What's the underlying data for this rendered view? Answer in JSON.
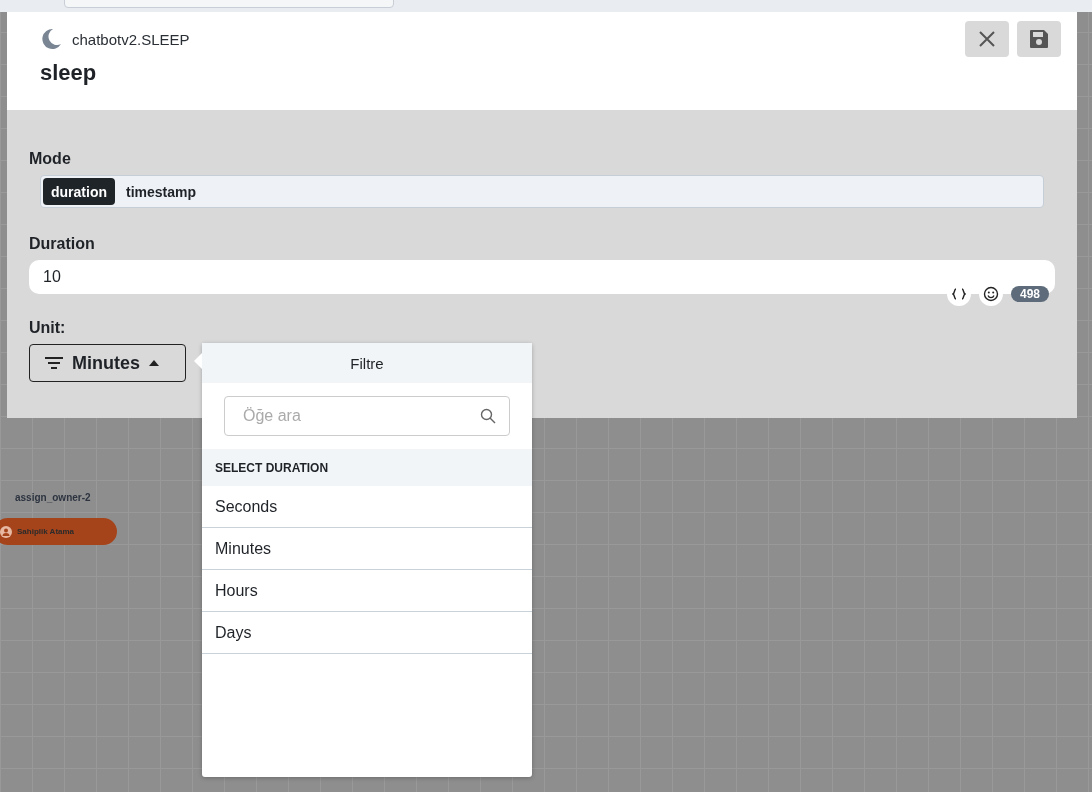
{
  "canvas": {
    "nodes": [
      {
        "name": "assign_owner-2",
        "label": "Sahiplik Atama"
      }
    ]
  },
  "modal": {
    "subtitle": "chatbotv2.SLEEP",
    "title": "sleep",
    "mode": {
      "label": "Mode",
      "options": [
        {
          "label": "duration",
          "selected": true
        },
        {
          "label": "timestamp",
          "selected": false
        }
      ]
    },
    "duration": {
      "label": "Duration",
      "value": "10",
      "count": "498"
    },
    "unit": {
      "label": "Unit:",
      "value": "Minutes",
      "expanded": true
    }
  },
  "popover": {
    "title": "Filtre",
    "search": {
      "placeholder": "Öğe ara"
    },
    "section": "SELECT DURATION",
    "items": [
      "Seconds",
      "Minutes",
      "Hours",
      "Days"
    ]
  }
}
